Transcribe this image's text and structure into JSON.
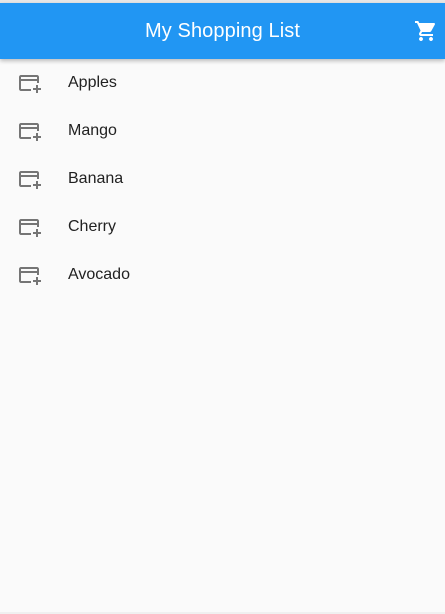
{
  "app_bar": {
    "title": "My Shopping List",
    "cart_icon": "shopping-cart-icon",
    "background_color": "#2196f3"
  },
  "list": {
    "item_icon": "add-card-icon",
    "items": [
      {
        "label": "Apples"
      },
      {
        "label": "Mango"
      },
      {
        "label": "Banana"
      },
      {
        "label": "Cherry"
      },
      {
        "label": "Avocado"
      }
    ]
  }
}
